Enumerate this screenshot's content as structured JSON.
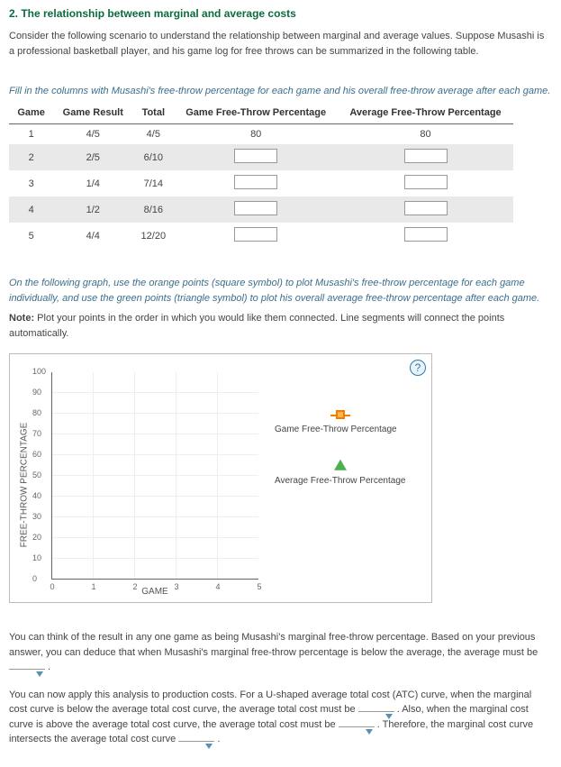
{
  "heading": "2. The relationship between marginal and average costs",
  "intro": "Consider the following scenario to understand the relationship between marginal and average values. Suppose Musashi is a professional basketball player, and his game log for free throws can be summarized in the following table.",
  "fill_in": "Fill in the columns with Musashi's free-throw percentage for each game and his overall free-throw average after each game.",
  "table": {
    "headers": [
      "Game",
      "Game Result",
      "Total",
      "Game Free-Throw Percentage",
      "Average Free-Throw Percentage"
    ],
    "rows": [
      {
        "game": "1",
        "result": "4/5",
        "total": "4/5",
        "gpct": "80",
        "apct": "80"
      },
      {
        "game": "2",
        "result": "2/5",
        "total": "6/10",
        "gpct": "",
        "apct": ""
      },
      {
        "game": "3",
        "result": "1/4",
        "total": "7/14",
        "gpct": "",
        "apct": ""
      },
      {
        "game": "4",
        "result": "1/2",
        "total": "8/16",
        "gpct": "",
        "apct": ""
      },
      {
        "game": "5",
        "result": "4/4",
        "total": "12/20",
        "gpct": "",
        "apct": ""
      }
    ]
  },
  "graph_instr": "On the following graph, use the orange points (square symbol) to plot Musashi's free-throw percentage for each game individually, and use the green points (triangle symbol) to plot his overall average free-throw percentage after each game.",
  "note_label": "Note:",
  "note_text": " Plot your points in the order in which you would like them connected. Line segments will connect the points automatically.",
  "chart": {
    "ylabel": "FREE-THROW PERCENTAGE",
    "xlabel": "GAME",
    "y_ticks": [
      "0",
      "10",
      "20",
      "30",
      "40",
      "50",
      "60",
      "70",
      "80",
      "90",
      "100"
    ],
    "x_ticks": [
      "0",
      "1",
      "2",
      "3",
      "4",
      "5"
    ],
    "legend1": "Game Free-Throw Percentage",
    "legend2": "Average Free-Throw Percentage",
    "help": "?"
  },
  "para2a": "You can think of the result in any one game as being Musashi's marginal free-throw percentage. Based on your previous answer, you can deduce that when Musashi's marginal free-throw percentage is below the average, the average must be ",
  "para2b": " .",
  "para3a": "You can now apply this analysis to production costs. For a U-shaped average total cost (ATC) curve, when the marginal cost curve is below the average total cost curve, the average total cost must be ",
  "para3b": " . Also, when the marginal cost curve is above the average total cost curve, the average total cost must be ",
  "para3c": " . Therefore, the marginal cost curve intersects the average total cost curve ",
  "para3d": " ."
}
